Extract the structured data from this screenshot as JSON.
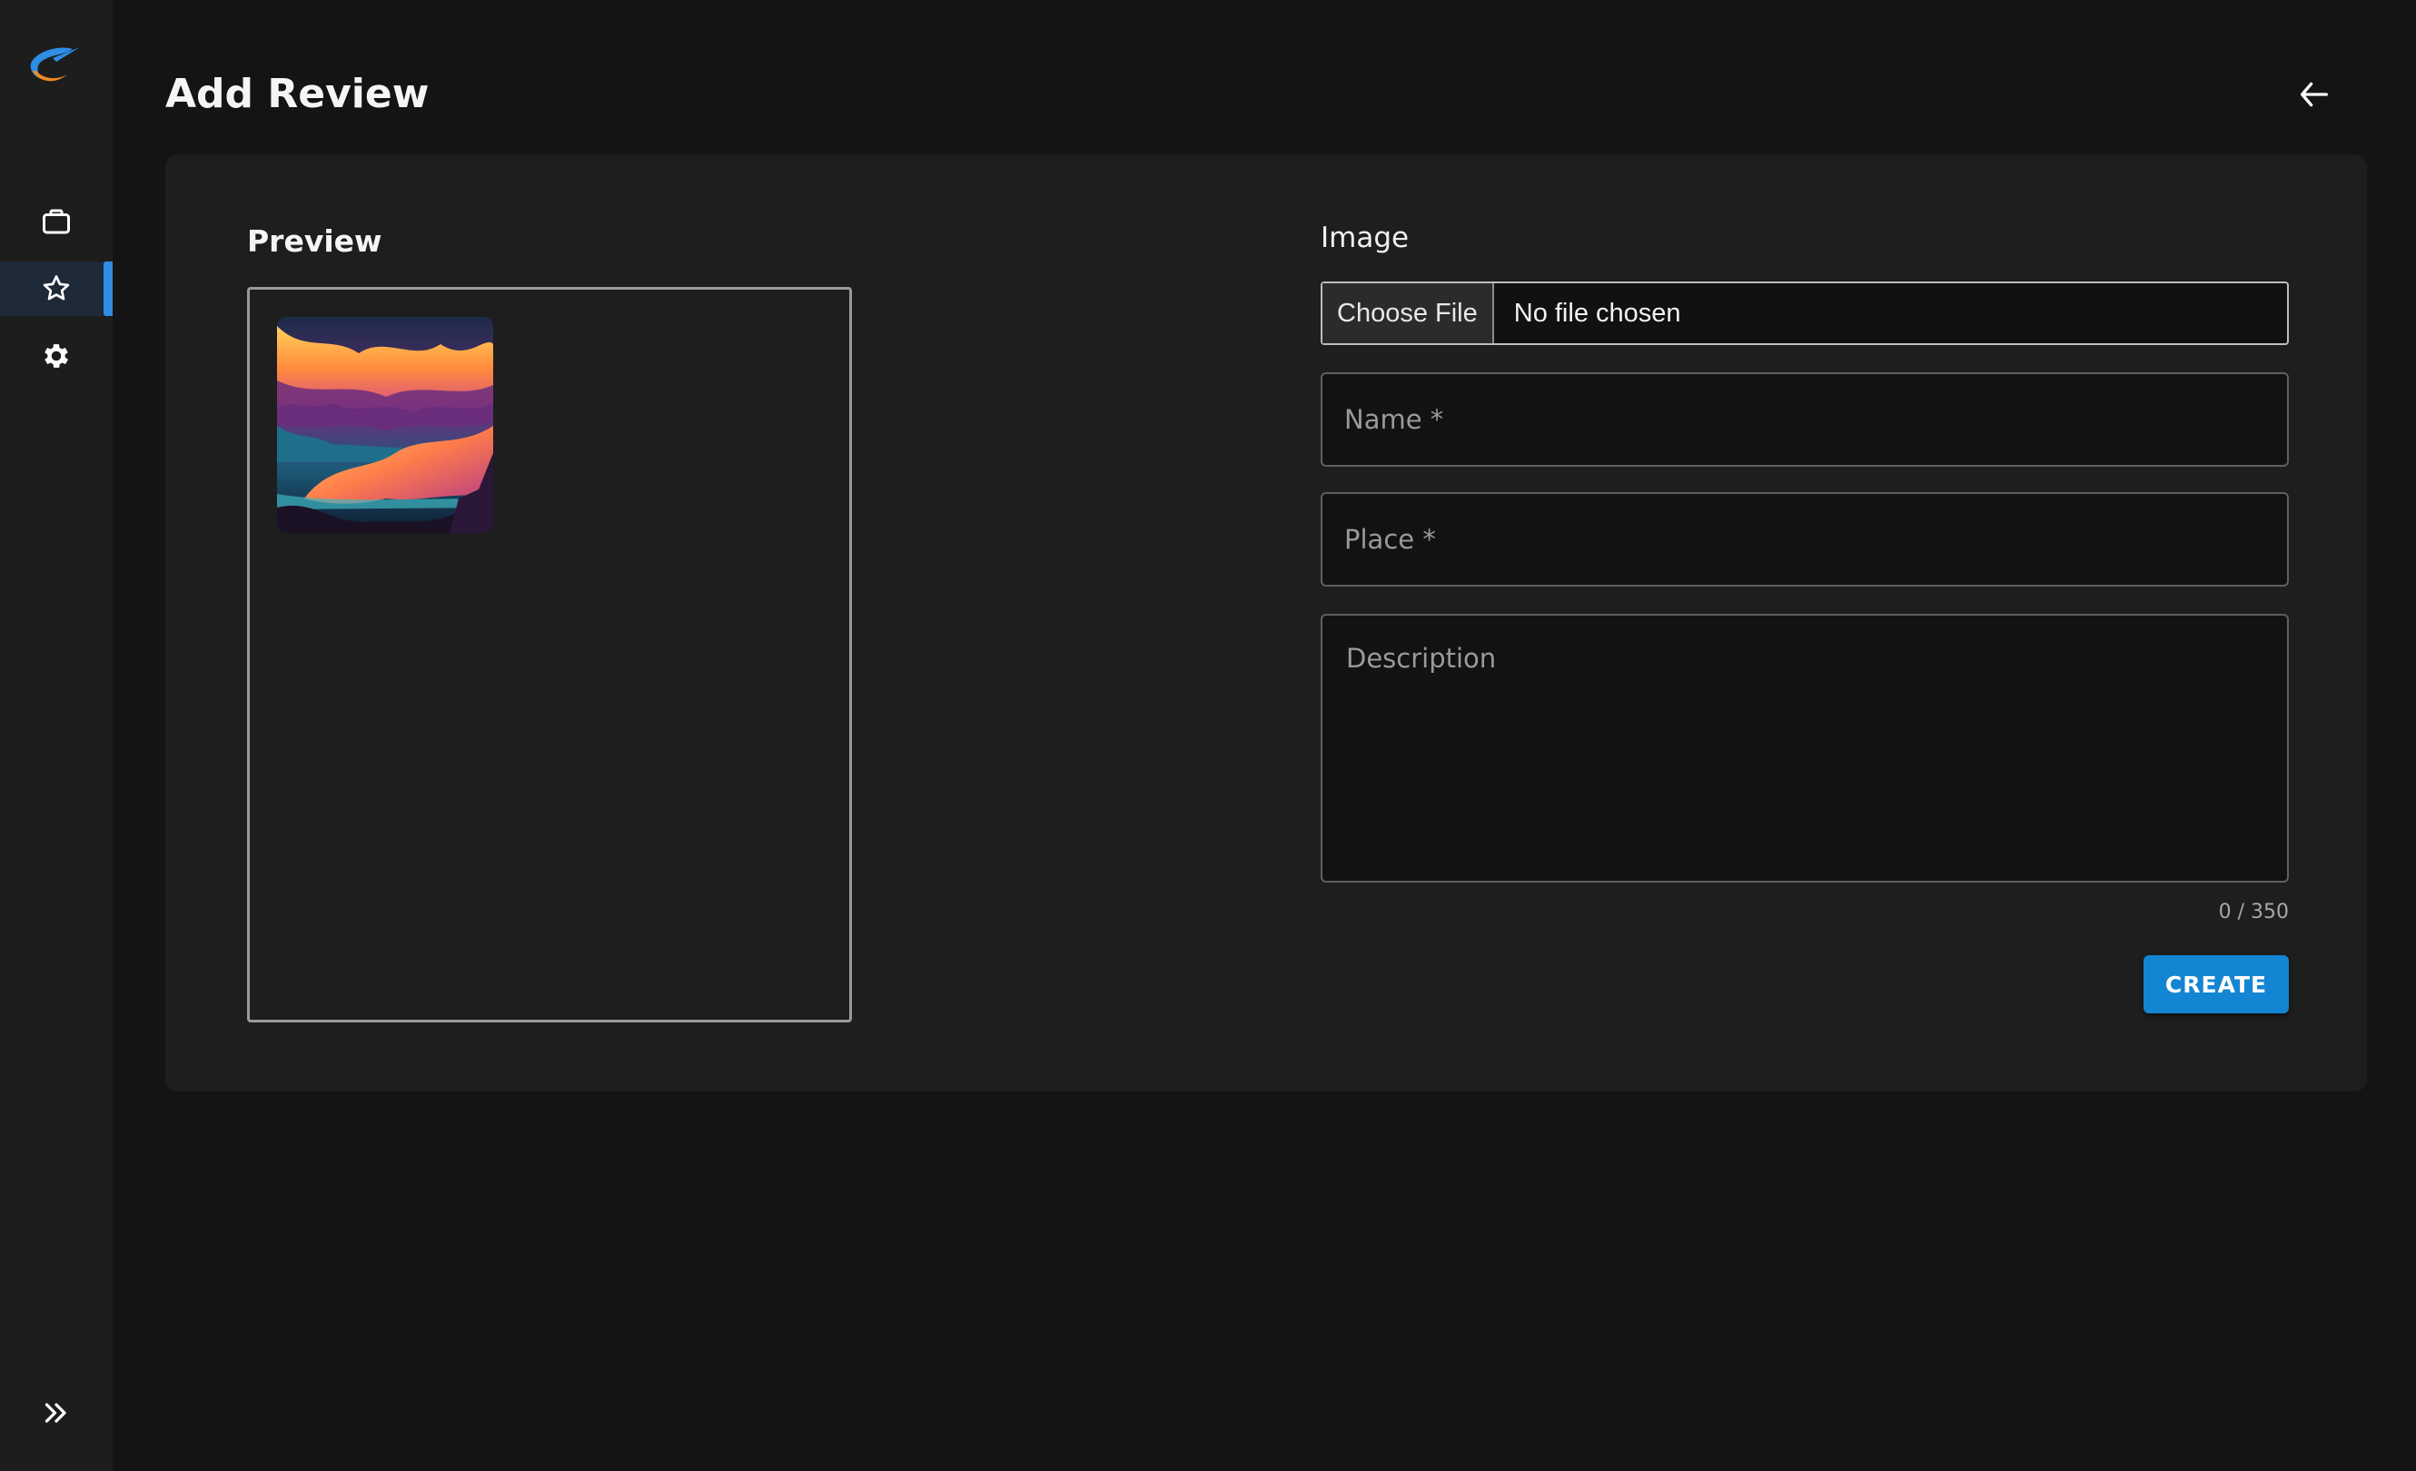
{
  "app": {
    "brand_colors": {
      "accent": "#1485d3",
      "logo_blue": "#2f8de4",
      "logo_orange": "#f08a28"
    }
  },
  "sidebar": {
    "items": [
      {
        "icon": "briefcase-icon"
      },
      {
        "icon": "star-icon",
        "active": true
      },
      {
        "icon": "gear-icon"
      }
    ],
    "expand_icon": "chevrons-right-icon"
  },
  "header": {
    "title": "Add Review",
    "back_icon": "arrow-left-icon"
  },
  "preview": {
    "title": "Preview"
  },
  "form": {
    "image_label": "Image",
    "choose_file_label": "Choose File",
    "file_status": "No file chosen",
    "name_placeholder": "Name *",
    "name_value": "",
    "place_placeholder": "Place *",
    "place_value": "",
    "description_placeholder": "Description",
    "description_value": "",
    "char_counter": "0 / 350",
    "create_label": "CREATE"
  }
}
